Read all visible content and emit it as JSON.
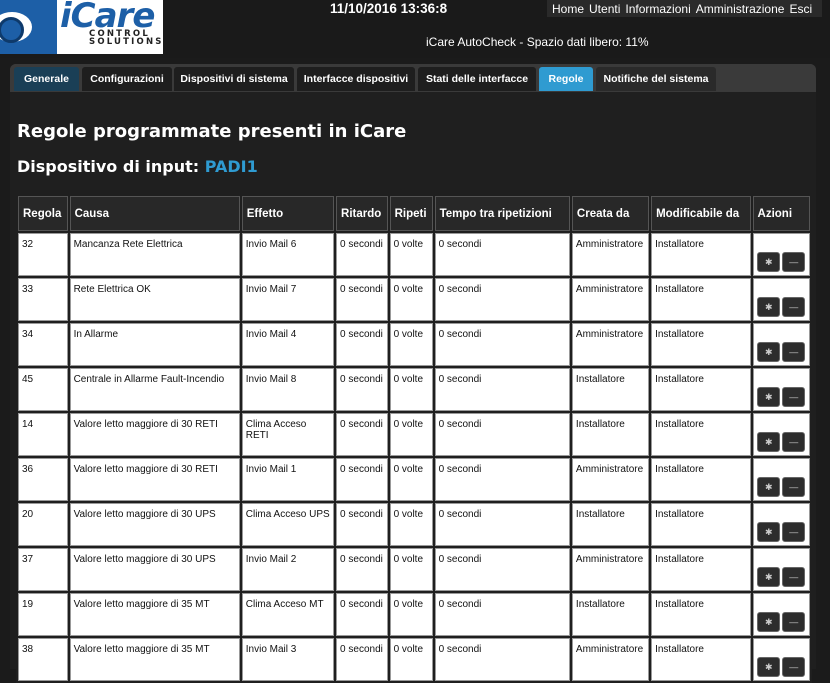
{
  "logo": {
    "text": "iCare",
    "sub1": "CONTROL",
    "sub2": "SOLUTIONS"
  },
  "header": {
    "datetime": "11/10/2016 13:36:8",
    "status": "iCare AutoCheck - Spazio dati libero: 11%",
    "nav": [
      "Home",
      "Utenti",
      "Informazioni",
      "Amministrazione",
      "Esci"
    ]
  },
  "tabs": [
    "Generale",
    "Configurazioni",
    "Dispositivi di sistema",
    "Interfacce dispositivi",
    "Stati delle interfacce",
    "Regole",
    "Notifiche del sistema"
  ],
  "page": {
    "title": "Regole programmate presenti in iCare",
    "device_label": "Dispositivo di input:",
    "device_name": "PADI1"
  },
  "table": {
    "headers": [
      "Regola",
      "Causa",
      "Effetto",
      "Ritardo",
      "Ripeti",
      "Tempo tra ripetizioni",
      "Creata da",
      "Modificabile da",
      "Azioni"
    ],
    "rows": [
      [
        "32",
        "Mancanza Rete Elettrica",
        "Invio Mail 6",
        "0 secondi",
        "0 volte",
        "0 secondi",
        "Amministratore",
        "Installatore"
      ],
      [
        "33",
        "Rete Elettrica OK",
        "Invio Mail 7",
        "0 secondi",
        "0 volte",
        "0 secondi",
        "Amministratore",
        "Installatore"
      ],
      [
        "34",
        "In Allarme",
        "Invio Mail 4",
        "0 secondi",
        "0 volte",
        "0 secondi",
        "Amministratore",
        "Installatore"
      ],
      [
        "45",
        "Centrale in Allarme Fault-Incendio",
        "Invio Mail 8",
        "0 secondi",
        "0 volte",
        "0 secondi",
        "Installatore",
        "Installatore"
      ],
      [
        "14",
        "Valore letto maggiore di 30 RETI",
        "Clima Acceso RETI",
        "0 secondi",
        "0 volte",
        "0 secondi",
        "Installatore",
        "Installatore"
      ],
      [
        "36",
        "Valore letto maggiore di 30 RETI",
        "Invio Mail 1",
        "0 secondi",
        "0 volte",
        "0 secondi",
        "Amministratore",
        "Installatore"
      ],
      [
        "20",
        "Valore letto maggiore di 30 UPS",
        "Clima Acceso UPS",
        "0 secondi",
        "0 volte",
        "0 secondi",
        "Installatore",
        "Installatore"
      ],
      [
        "37",
        "Valore letto maggiore di 30 UPS",
        "Invio Mail 2",
        "0 secondi",
        "0 volte",
        "0 secondi",
        "Amministratore",
        "Installatore"
      ],
      [
        "19",
        "Valore letto maggiore di 35 MT",
        "Clima Acceso MT",
        "0 secondi",
        "0 volte",
        "0 secondi",
        "Installatore",
        "Installatore"
      ],
      [
        "38",
        "Valore letto maggiore di 35 MT",
        "Invio Mail 3",
        "0 secondi",
        "0 volte",
        "0 secondi",
        "Amministratore",
        "Installatore"
      ]
    ]
  },
  "actions": {
    "settings_icon": "gear-icon",
    "remove_icon": "minus-icon"
  },
  "colors": {
    "accent": "#2f9bd1",
    "brand": "#1d5fa7"
  }
}
